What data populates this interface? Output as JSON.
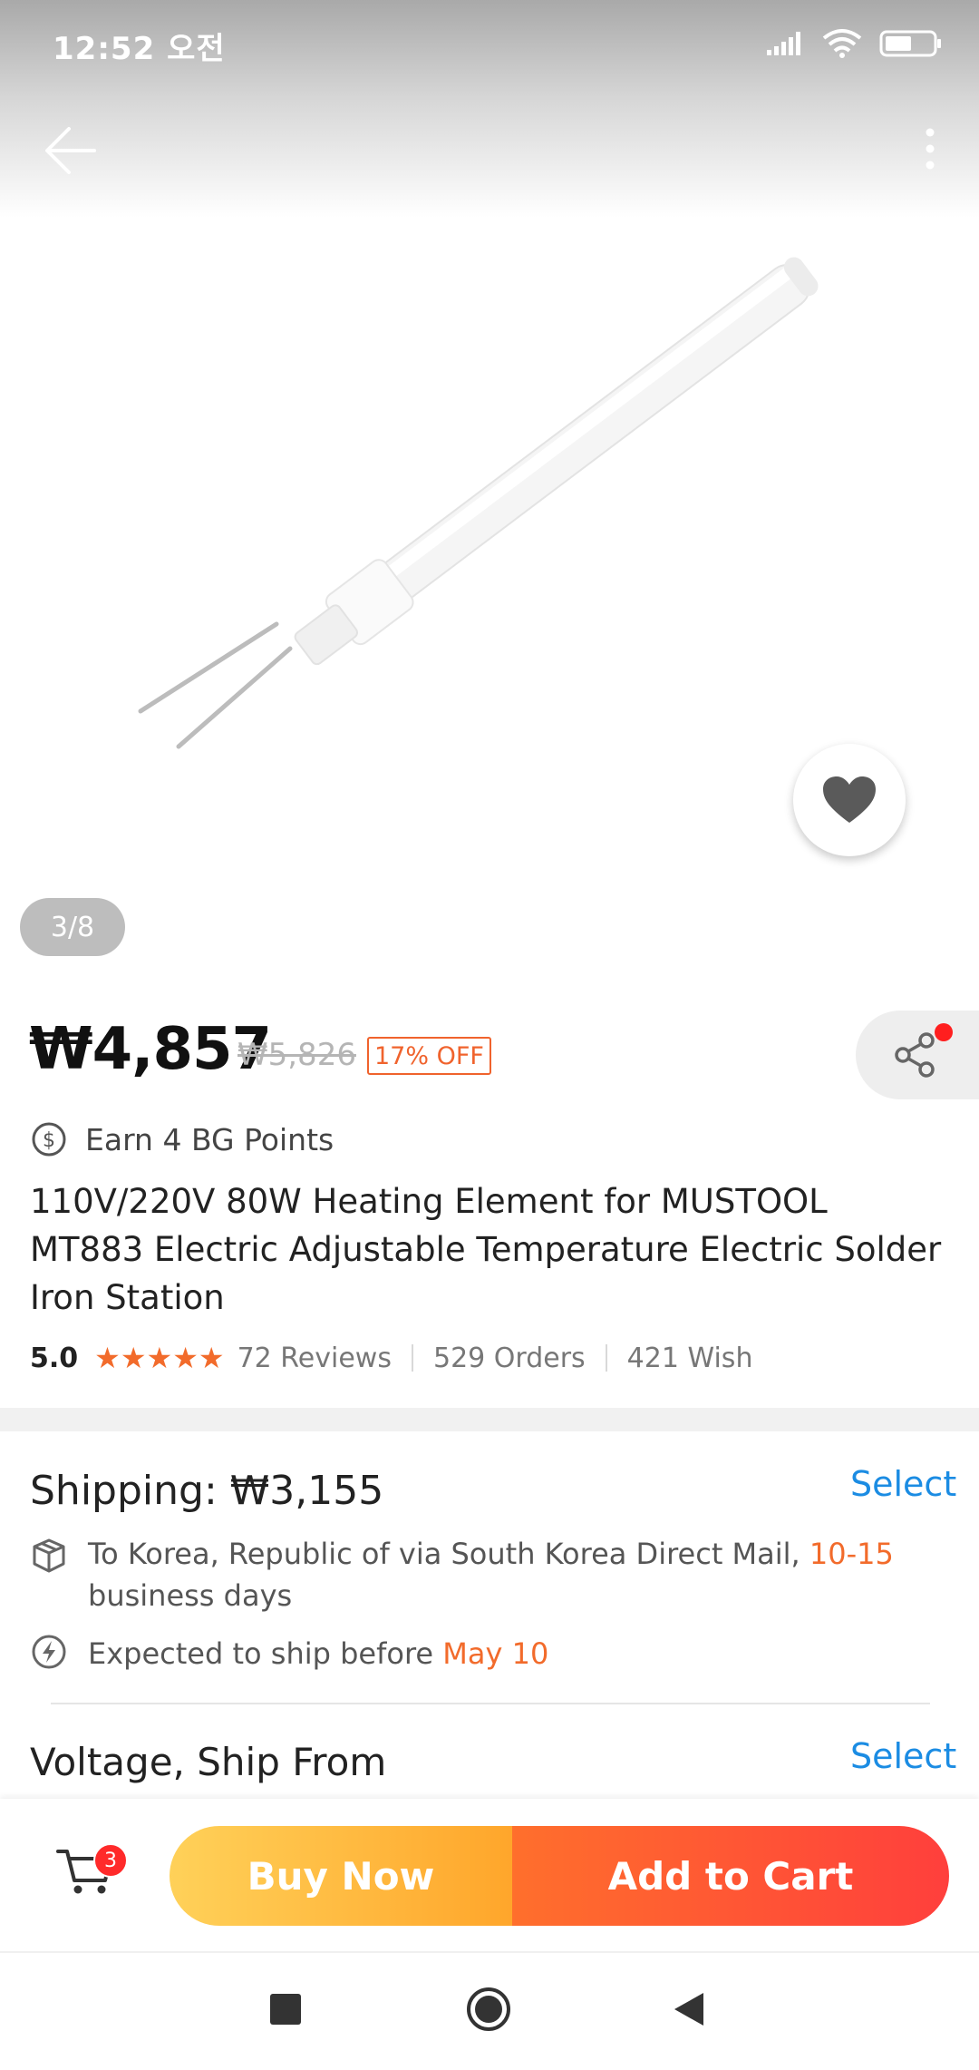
{
  "status_bar": {
    "time": "12:52 오전"
  },
  "gallery": {
    "counter": "3/8"
  },
  "price": {
    "current": "₩4,857",
    "original": "₩5,826",
    "discount": "17% OFF"
  },
  "points": {
    "label": "Earn 4 BG Points"
  },
  "product": {
    "title": "110V/220V 80W Heating Element for MUSTOOL MT883 Electric Adjustable Temperature Electric Solder Iron Station"
  },
  "stats": {
    "rating": "5.0",
    "stars": "★★★★★",
    "reviews": "72 Reviews",
    "orders": "529 Orders",
    "wish": "421 Wish"
  },
  "shipping": {
    "label": "Shipping:",
    "cost": "₩3,155",
    "select": "Select",
    "route_prefix": "To Korea, Republic of via South Korea Direct Mail,",
    "route_days": "10-15",
    "route_suffix": "business days",
    "expected_prefix": "Expected to ship before",
    "expected_date": "May 10"
  },
  "options": {
    "label": "Voltage, Ship From",
    "select": "Select"
  },
  "action_bar": {
    "cart_count": "3",
    "buy_now": "Buy Now",
    "add_to_cart": "Add to Cart"
  },
  "colors": {
    "accent_orange": "#f26b2b",
    "link_blue": "#1b8ce3",
    "buy_now_gradient": [
      "#ffd159",
      "#ffa62b"
    ],
    "add_cart_gradient": [
      "#ff6f2c",
      "#ff3f3c"
    ]
  }
}
